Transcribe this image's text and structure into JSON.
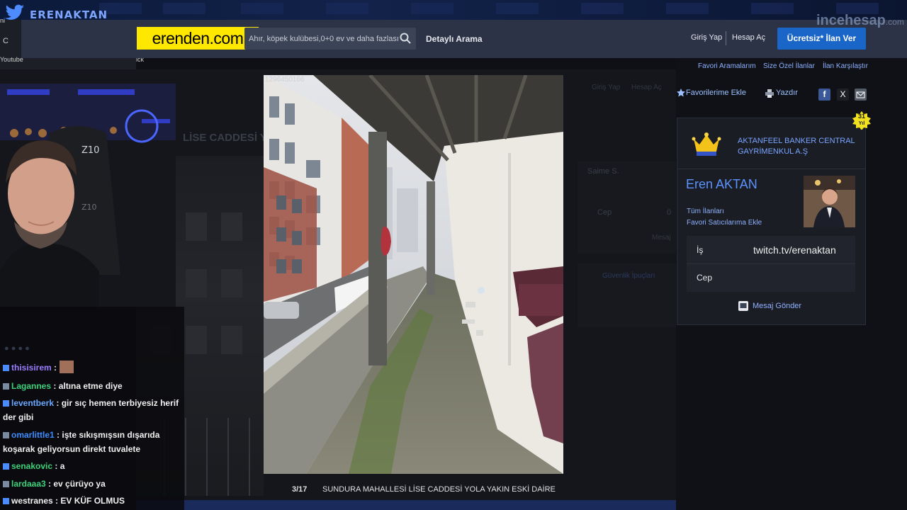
{
  "overlay": {
    "brand_name": "ERENAKTAN"
  },
  "browser": {
    "reload_glyph": "C",
    "bookmark_youtube": "Youtube",
    "bookmark_right": "ick",
    "tab_partial": "ni"
  },
  "header": {
    "logo_text": "erenden.com",
    "search_placeholder": "Ahır, köpek kulübesi,0+0 ev ve daha fazlası",
    "advanced_search": "Detaylı Arama",
    "login": "Giriş Yap",
    "register": "Hesap Aç",
    "post_ad": "Ücretsiz* İlan Ver",
    "watermark_brand": "incehesap",
    "watermark_tld": ".com"
  },
  "subnav": {
    "links": [
      "Favori Aramalarım",
      "Size Özel İlanlar",
      "İlan Karşılaştır"
    ]
  },
  "actions": {
    "favorite": "Favorilerime Ekle",
    "print": "Yazdır",
    "facebook_glyph": "f",
    "x_glyph": "X"
  },
  "listing": {
    "ghost_title": "LİSE CADDESİ Y",
    "ghost_labels": [
      "Giriş Yap",
      "Hesap Aç",
      "Saime S.",
      "Cep",
      "0",
      "Güvenlik İpuçları",
      "Mesaj"
    ],
    "photo_id": "1296450166",
    "photo_counter": "3/17",
    "photo_caption": "SUNDURA MAHALLESİ LİSE CADDESİ YOLA YAKIN ESKİ DAİRE"
  },
  "seller": {
    "agency": "AKTANFEEL BANKER CENTRAL GAYRİMENKUL A.Ş",
    "years": "31",
    "years_label": "Yıl",
    "name": "Eren AKTAN",
    "all_ads": "Tüm İlanları",
    "fav_seller": "Favori Satıcılarıma Ekle",
    "work_label": "İş",
    "work_value": "twitch.tv/erenaktan",
    "cell_label": "Cep",
    "send_message": "Mesaj Gönder"
  },
  "chat": {
    "messages": [
      {
        "user": "thisisirem",
        "text": ":",
        "color": "#9a7dff",
        "emote": true
      },
      {
        "user": "Lagannes",
        "text": ": altına etme diye",
        "color": "#3cd27c"
      },
      {
        "user": "leventberk",
        "text": ": gir sıç hemen terbiyesiz herif der gibi",
        "color": "#6aa8ff"
      },
      {
        "user": "omarlittle1",
        "text": ": işte sıkışmışsın dışarıda koşarak geliyorsun direkt tuvalete",
        "color": "#3c8cff"
      },
      {
        "user": "senakovic",
        "text": ": a",
        "color": "#3cd27c"
      },
      {
        "user": "lardaaa3",
        "text": ": ev çürüyo ya",
        "color": "#3cd27c"
      },
      {
        "user": "westranes",
        "text": ": EV KÜF OLMUS",
        "color": "#f0f0f0"
      }
    ]
  },
  "colors": {
    "logo_bg": "#ffe800",
    "header_bg": "#2c3346",
    "cta_blue": "#1a66c8",
    "link_blue": "#8fb1ff"
  }
}
